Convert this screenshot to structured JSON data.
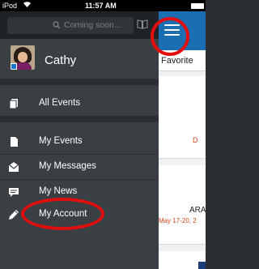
{
  "status_bar": {
    "carrier": "iPod",
    "time": "11:57 AM"
  },
  "menu": {
    "search_placeholder": "Coming soon...",
    "profile_name": "Cathy",
    "items": [
      {
        "label": "All Events",
        "icon": "document-icon"
      },
      {
        "label": "My Events",
        "icon": "document-icon"
      },
      {
        "label": "My Messages",
        "icon": "envelope-icon"
      },
      {
        "label": "My News",
        "icon": "news-icon"
      },
      {
        "label": "My Account",
        "icon": "pencil-icon"
      }
    ]
  },
  "main": {
    "tab_label": "Favorite",
    "card1_text": "D",
    "card2_title": "ARA",
    "card2_date": "May 17-20, 2"
  },
  "colors": {
    "navbar": "#1b6eb2",
    "menu_bg": "#3a3f44",
    "date_accent": "#d0461a",
    "annotation": "#e10e0e"
  }
}
